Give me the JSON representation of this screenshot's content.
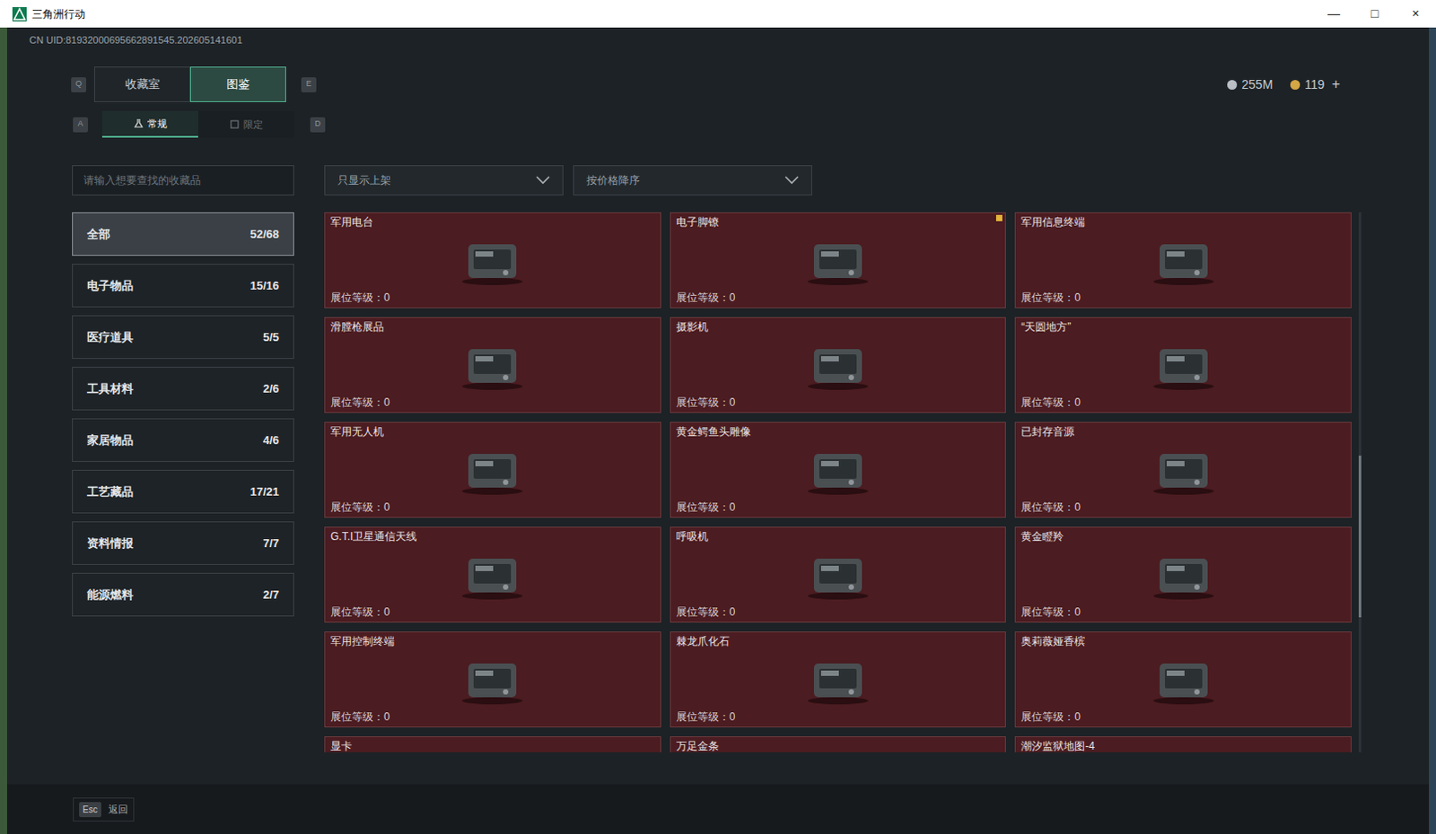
{
  "window": {
    "title": "三角洲行动",
    "controls": [
      "—",
      "□",
      "×"
    ]
  },
  "uid": "CN UID:81932000695662891545.202605141601",
  "tabs": {
    "prev_key": "Q",
    "next_key": "E",
    "items": [
      {
        "label": "收藏室",
        "selected": false
      },
      {
        "label": "图鉴",
        "selected": true
      }
    ]
  },
  "subtabs": {
    "prev_key": "A",
    "next_key": "D",
    "items": [
      {
        "label": "常规",
        "selected": true
      },
      {
        "label": "限定",
        "selected": false
      }
    ]
  },
  "currency": [
    {
      "amount": "255M"
    },
    {
      "amount": "119"
    }
  ],
  "currency_add": "+",
  "search": {
    "placeholder": "请输入想要查找的收藏品"
  },
  "filters": [
    {
      "label": "只显示上架"
    },
    {
      "label": "按价格降序"
    }
  ],
  "categories": [
    {
      "name": "全部",
      "count": "52/68",
      "selected": true
    },
    {
      "name": "电子物品",
      "count": "15/16",
      "selected": false
    },
    {
      "name": "医疗道具",
      "count": "5/5",
      "selected": false
    },
    {
      "name": "工具材料",
      "count": "2/6",
      "selected": false
    },
    {
      "name": "家居物品",
      "count": "4/6",
      "selected": false
    },
    {
      "name": "工艺藏品",
      "count": "17/21",
      "selected": false
    },
    {
      "name": "资料情报",
      "count": "7/7",
      "selected": false
    },
    {
      "name": "能源燃料",
      "count": "2/7",
      "selected": false
    }
  ],
  "items": [
    {
      "name": "军用电台",
      "level_text": "展位等级：0",
      "marked": false
    },
    {
      "name": "电子脚镣",
      "level_text": "展位等级：0",
      "marked": true
    },
    {
      "name": "军用信息终端",
      "level_text": "展位等级：0",
      "marked": false
    },
    {
      "name": "滑膛枪展品",
      "level_text": "展位等级：0",
      "marked": false
    },
    {
      "name": "摄影机",
      "level_text": "展位等级：0",
      "marked": false
    },
    {
      "name": "“天圆地方”",
      "level_text": "展位等级：0",
      "marked": false
    },
    {
      "name": "军用无人机",
      "level_text": "展位等级：0",
      "marked": false
    },
    {
      "name": "黄金鳄鱼头雕像",
      "level_text": "展位等级：0",
      "marked": false
    },
    {
      "name": "已封存音源",
      "level_text": "展位等级：0",
      "marked": false
    },
    {
      "name": "G.T.I卫星通信天线",
      "level_text": "展位等级：0",
      "marked": false
    },
    {
      "name": "呼吸机",
      "level_text": "展位等级：0",
      "marked": false
    },
    {
      "name": "黄金瞪羚",
      "level_text": "展位等级：0",
      "marked": false
    },
    {
      "name": "军用控制终端",
      "level_text": "展位等级：0",
      "marked": false
    },
    {
      "name": "棘龙爪化石",
      "level_text": "展位等级：0",
      "marked": false
    },
    {
      "name": "奥莉薇娅香槟",
      "level_text": "展位等级：0",
      "marked": false
    },
    {
      "name": "显卡",
      "marked": false
    },
    {
      "name": "万足金条",
      "marked": false
    },
    {
      "name": "潮汐监狱地图-4",
      "marked": false
    }
  ],
  "scroll": {
    "start": 0.45,
    "size": 0.3
  },
  "footer": {
    "key": "Esc",
    "label": "返回"
  }
}
